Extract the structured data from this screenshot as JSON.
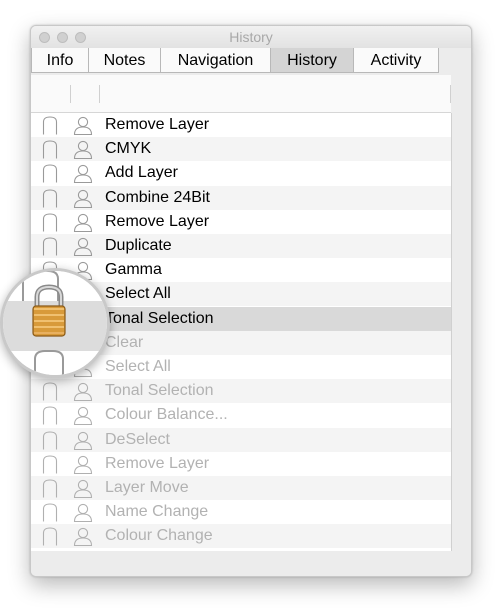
{
  "window": {
    "title": "History"
  },
  "tabs": [
    {
      "label": "Info"
    },
    {
      "label": "Notes"
    },
    {
      "label": "Navigation"
    },
    {
      "label": "History",
      "selected": true
    },
    {
      "label": "Activity"
    }
  ],
  "history": [
    {
      "label": "Remove Layer",
      "state": "active"
    },
    {
      "label": "CMYK",
      "state": "active"
    },
    {
      "label": "Add Layer",
      "state": "active"
    },
    {
      "label": "Combine 24Bit",
      "state": "active"
    },
    {
      "label": "Remove Layer",
      "state": "active"
    },
    {
      "label": "Duplicate",
      "state": "active"
    },
    {
      "label": "Gamma",
      "state": "active"
    },
    {
      "label": "Select All",
      "state": "active"
    },
    {
      "label": "Tonal Selection",
      "state": "selected"
    },
    {
      "label": "Clear",
      "state": "undone"
    },
    {
      "label": "Select All",
      "state": "undone"
    },
    {
      "label": "Tonal Selection",
      "state": "undone"
    },
    {
      "label": "Colour Balance...",
      "state": "undone"
    },
    {
      "label": "DeSelect",
      "state": "undone"
    },
    {
      "label": "Remove Layer",
      "state": "undone"
    },
    {
      "label": "Layer Move",
      "state": "undone"
    },
    {
      "label": "Name Change",
      "state": "undone"
    },
    {
      "label": "Colour Change",
      "state": "undone"
    }
  ],
  "icons": {
    "column1": "lock-icon",
    "column2": "user-icon",
    "magnified": "padlock-locked-icon"
  },
  "colors": {
    "selected_row": "#d9d9d9",
    "undone_text": "#b2b2b2",
    "padlock_body": "#d89a3a"
  }
}
